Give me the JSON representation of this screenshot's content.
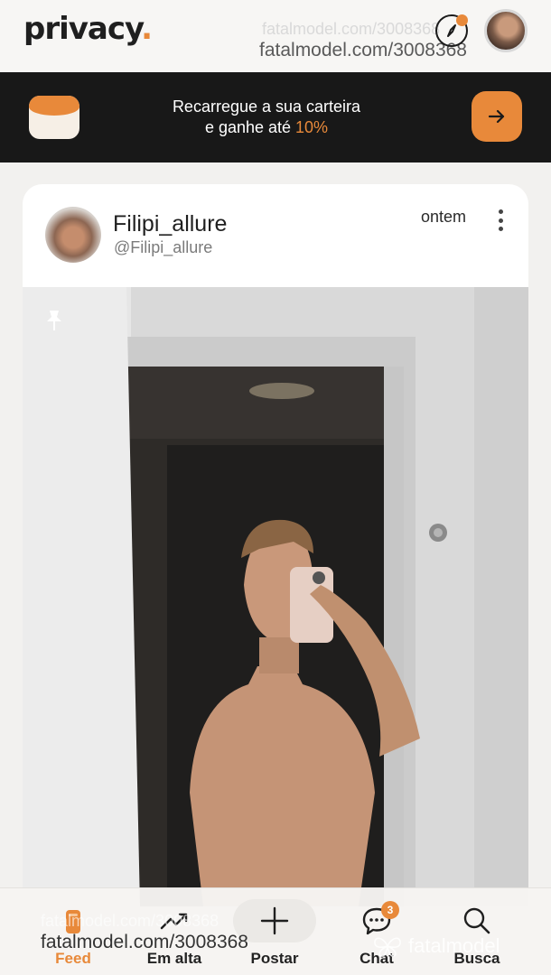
{
  "header": {
    "logo_text": "privacy",
    "logo_dot": ".",
    "watermark": "fatalmodel.com/3008368",
    "watermark_ghost": "fatalmodel.com/3008368",
    "compass_icon": "compass-icon",
    "notification_dot_color": "#e8893a"
  },
  "banner": {
    "line1": "Recarregue a sua carteira",
    "line2_prefix": "e ganhe até ",
    "line2_highlight": "10%",
    "wallet_icon": "wallet-icon",
    "cta_icon": "arrow-right-icon",
    "accent": "#e8893a",
    "background": "#181818"
  },
  "post": {
    "author_name": "Filipi_allure",
    "author_handle": "@Filipi_allure",
    "time": "ontem",
    "menu_icon": "more-vertical-icon",
    "pin_icon": "pin-icon"
  },
  "nav": {
    "items": [
      {
        "label": "Feed",
        "icon": "feed-icon",
        "active": true
      },
      {
        "label": "Em alta",
        "icon": "trending-icon",
        "active": false
      },
      {
        "label": "Postar",
        "icon": "plus-icon",
        "active": false
      },
      {
        "label": "Chat",
        "icon": "chat-icon",
        "active": false
      },
      {
        "label": "Busca",
        "icon": "search-icon",
        "active": false
      }
    ],
    "chat_badge": "3"
  },
  "footer_watermark": {
    "url": "fatalmodel.com/3008368",
    "url_ghost": "fatalmodel.com/3008368",
    "brand": "fatalmodel"
  },
  "colors": {
    "accent": "#e8893a",
    "text_dark": "#1f1f1f",
    "muted": "#7b7b7b"
  }
}
